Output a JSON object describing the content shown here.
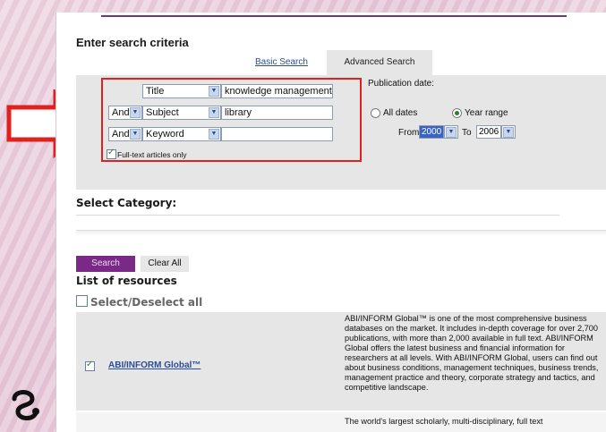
{
  "page": {
    "title": "Enter search criteria",
    "tabs": {
      "basic": "Basic Search",
      "advanced": "Advanced Search"
    }
  },
  "criteria": {
    "rows": [
      {
        "operator": "",
        "field": "Title",
        "value": "knowledge management"
      },
      {
        "operator": "And",
        "field": "Subject",
        "value": "library"
      },
      {
        "operator": "And",
        "field": "Keyword",
        "value": ""
      }
    ],
    "fulltext_label": "Full-text articles only",
    "fulltext_checked": true
  },
  "publication": {
    "label": "Publication date:",
    "all_dates": "All dates",
    "year_range": "Year range",
    "selected": "Year range",
    "from_label": "From",
    "from_value": "2000",
    "to_label": "To",
    "to_value": "2006"
  },
  "category": {
    "title": "Select Category:"
  },
  "buttons": {
    "search": "Search",
    "clear": "Clear All"
  },
  "resources": {
    "title": "List of resources",
    "select_all": "Select/Deselect all",
    "items": [
      {
        "name": "ABI/INFORM Global™",
        "checked": true,
        "description": "ABI/INFORM Global™ is one of the most comprehensive business databases on the market. It includes in-depth coverage for over 2,700 publications, with more than 2,000 available in full text. ABI/INFORM Global offers the latest business and financial information for researchers at all levels. With ABI/INFORM Global, users can find out about business conditions, management techniques, business trends, management practice and theory, corporate strategy and tactics, and competitive landscape."
      },
      {
        "name": "",
        "description": "The world's largest scholarly, multi-disciplinary, full text"
      }
    ]
  },
  "colors": {
    "accent": "#7a2a86",
    "highlight": "#e0221f",
    "link": "#2a4d9a"
  }
}
